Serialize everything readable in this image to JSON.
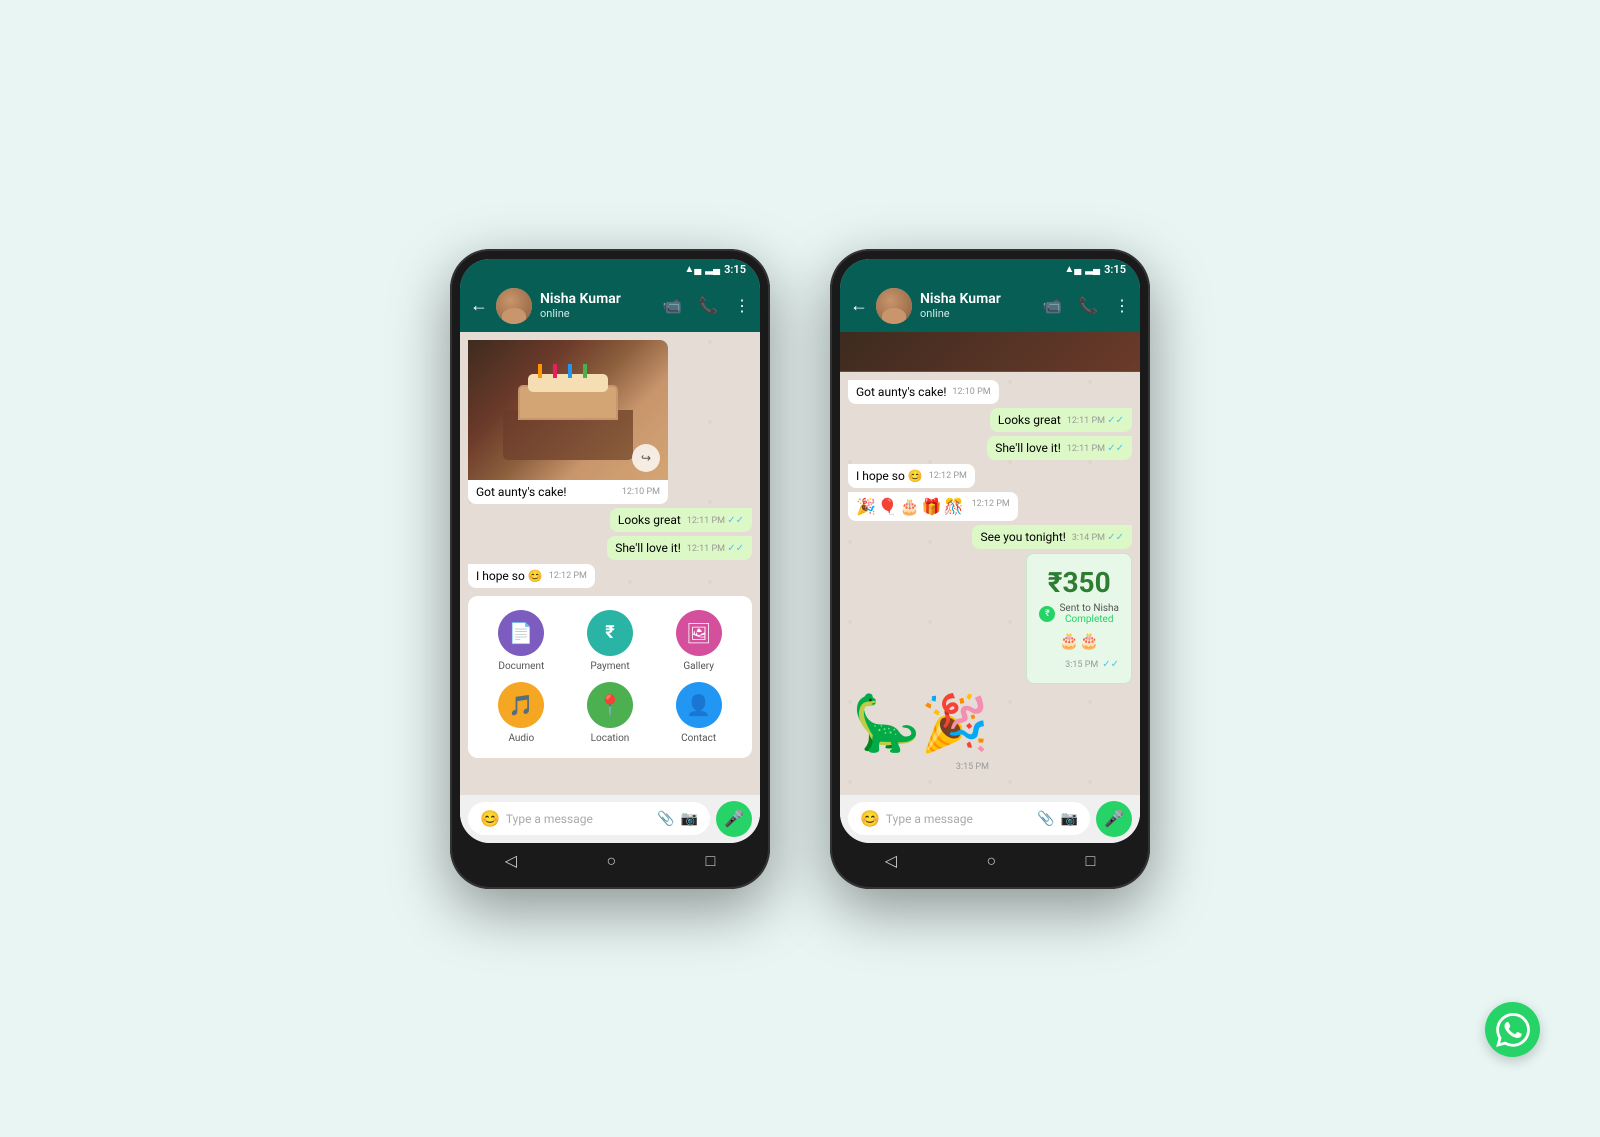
{
  "background_color": "#e8f5f3",
  "phones": [
    {
      "id": "phone-left",
      "status_bar": {
        "time": "3:15",
        "signal": "▲▄",
        "wifi": "📶",
        "battery": "■"
      },
      "header": {
        "contact_name": "Nisha Kumar",
        "status": "online",
        "back_label": "←",
        "video_icon": "📹",
        "call_icon": "📞",
        "menu_icon": "⋮"
      },
      "messages": [
        {
          "type": "image-with-text",
          "direction": "received",
          "text": "Got aunty's cake!",
          "time": "12:10 PM",
          "has_image": true
        },
        {
          "type": "text",
          "direction": "sent",
          "text": "Looks great",
          "time": "12:11 PM",
          "ticks": "✓✓"
        },
        {
          "type": "text",
          "direction": "sent",
          "text": "She'll love it!",
          "time": "12:11 PM",
          "ticks": "✓✓"
        },
        {
          "type": "text",
          "direction": "received",
          "text": "I hope so 😊",
          "time": "12:12 PM"
        }
      ],
      "attachment_menu": {
        "visible": true,
        "items": [
          {
            "label": "Document",
            "icon_class": "icon-document",
            "icon": "📄"
          },
          {
            "label": "Payment",
            "icon_class": "icon-payment",
            "icon": "₹"
          },
          {
            "label": "Gallery",
            "icon_class": "icon-gallery",
            "icon": "🖼"
          },
          {
            "label": "Audio",
            "icon_class": "icon-audio",
            "icon": "🎵"
          },
          {
            "label": "Location",
            "icon_class": "icon-location",
            "icon": "📍"
          },
          {
            "label": "Contact",
            "icon_class": "icon-contact",
            "icon": "👤"
          }
        ]
      },
      "input_bar": {
        "placeholder": "Type a message",
        "emoji_icon": "😊",
        "attach_icon": "📎",
        "camera_icon": "📷",
        "mic_icon": "🎤"
      }
    },
    {
      "id": "phone-right",
      "status_bar": {
        "time": "3:15"
      },
      "header": {
        "contact_name": "Nisha Kumar",
        "status": "online"
      },
      "messages": [
        {
          "type": "text",
          "direction": "received",
          "text": "Got aunty's cake!",
          "time": "12:10 PM"
        },
        {
          "type": "text",
          "direction": "sent",
          "text": "Looks great",
          "time": "12:11 PM",
          "ticks": "✓✓"
        },
        {
          "type": "text",
          "direction": "sent",
          "text": "She'll love it!",
          "time": "12:11 PM",
          "ticks": "✓✓"
        },
        {
          "type": "text",
          "direction": "received",
          "text": "I hope so 😊",
          "time": "12:12 PM"
        },
        {
          "type": "emoji",
          "direction": "received",
          "text": "🎉🎈🎂🎁🎊",
          "time": "12:12 PM"
        },
        {
          "type": "text",
          "direction": "sent",
          "text": "See you tonight!",
          "time": "3:14 PM",
          "ticks": "✓✓"
        },
        {
          "type": "payment",
          "direction": "sent",
          "amount": "₹350",
          "sent_to": "Sent to Nisha",
          "status": "Completed",
          "time": "3:15 PM",
          "ticks": "✓✓",
          "emoji": "🎂🎂"
        },
        {
          "type": "sticker",
          "direction": "received",
          "emoji": "🦕",
          "time": "3:15 PM"
        }
      ],
      "input_bar": {
        "placeholder": "Type a message"
      }
    }
  ],
  "wa_logo": "✓"
}
